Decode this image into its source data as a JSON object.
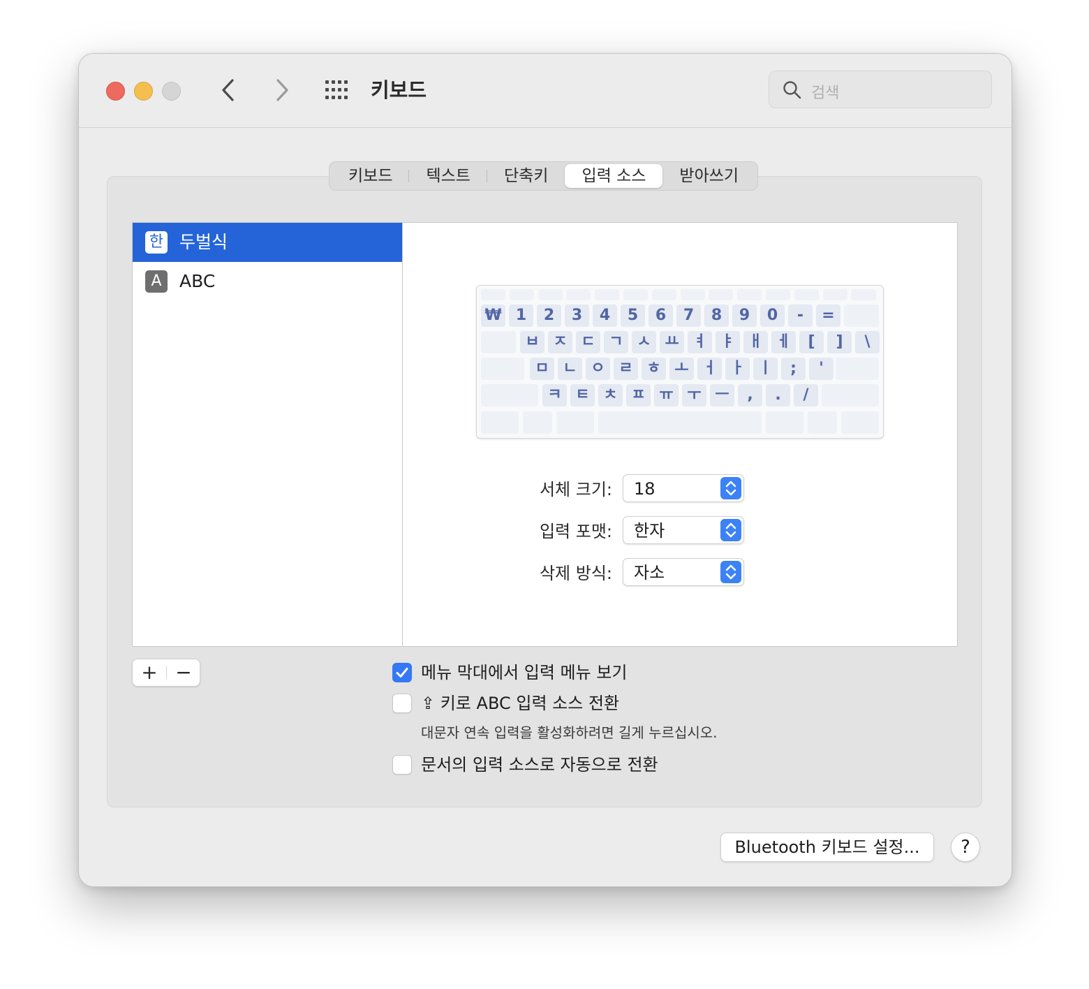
{
  "window": {
    "title": "키보드"
  },
  "search": {
    "placeholder": "검색",
    "icon": "magnifier"
  },
  "toolbar": {
    "back_icon": "chevron-left",
    "forward_icon": "chevron-right",
    "grid_icon": "grid"
  },
  "tabs": [
    {
      "label": "키보드",
      "selected": false
    },
    {
      "label": "텍스트",
      "selected": false
    },
    {
      "label": "단축키",
      "selected": false
    },
    {
      "label": "입력 소스",
      "selected": true
    },
    {
      "label": "받아쓰기",
      "selected": false
    }
  ],
  "sources": [
    {
      "icon_text": "한",
      "label": "두벌식",
      "selected": true
    },
    {
      "icon_text": "A",
      "label": "ABC",
      "selected": false
    }
  ],
  "keyboard": {
    "row1": [
      "₩",
      "1",
      "2",
      "3",
      "4",
      "5",
      "6",
      "7",
      "8",
      "9",
      "0",
      "-",
      "="
    ],
    "row2": [
      "ㅂ",
      "ㅈ",
      "ㄷ",
      "ㄱ",
      "ㅅ",
      "ㅛ",
      "ㅕ",
      "ㅑ",
      "ㅐ",
      "ㅔ",
      "[",
      "]",
      "\\"
    ],
    "row3": [
      "ㅁ",
      "ㄴ",
      "ㅇ",
      "ㄹ",
      "ㅎ",
      "ㅗ",
      "ㅓ",
      "ㅏ",
      "ㅣ",
      ";",
      "'"
    ],
    "row4": [
      "ㅋ",
      "ㅌ",
      "ㅊ",
      "ㅍ",
      "ㅠ",
      "ㅜ",
      "ㅡ",
      ",",
      ".",
      "/"
    ]
  },
  "form": {
    "font_size_label": "서체 크기:",
    "font_size_value": "18",
    "input_format_label": "입력 포맷:",
    "input_format_value": "한자",
    "delete_mode_label": "삭제 방식:",
    "delete_mode_value": "자소"
  },
  "buttons": {
    "add": "+",
    "remove": "−",
    "bluetooth": "Bluetooth 키보드 설정...",
    "help": "?"
  },
  "options": {
    "show_menu": {
      "label": "메뉴 막대에서 입력 메뉴 보기",
      "checked": true
    },
    "caps_switch": {
      "label": "⇪ 키로 ABC 입력 소스 전환",
      "checked": false,
      "hint": "대문자 연속 입력을 활성화하려면 길게 누르십시오."
    },
    "auto_switch": {
      "label": "문서의 입력 소스로 자동으로 전환",
      "checked": false
    }
  },
  "colors": {
    "accent": "#3478f6",
    "selection": "#2464d8",
    "key_text": "#5266a4"
  }
}
